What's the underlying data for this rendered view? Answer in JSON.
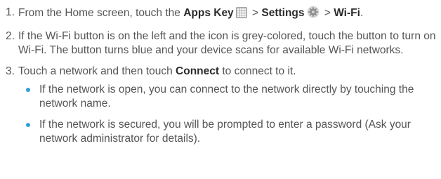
{
  "steps": [
    {
      "num": "1.",
      "t1": "From the Home screen, touch the ",
      "apps_key": "Apps Key",
      "sep1": " > ",
      "settings": "Settings",
      "sep2": " > ",
      "wifi": "Wi-Fi",
      "end": "."
    },
    {
      "num": "2.",
      "text": "If the Wi-Fi button is on the left and the icon is grey-colored, touch the button to turn on Wi-Fi. The button turns blue and your device scans for available Wi-Fi networks."
    },
    {
      "num": "3.",
      "t1": "Touch a network and then touch ",
      "connect": "Connect",
      "t2": " to connect to it."
    }
  ],
  "bullets": [
    "If the network is open, you can connect to the network directly by touching the network name.",
    "If the network is secured, you will be prompted to enter a password (Ask your network administrator for details)."
  ],
  "icons": {
    "apps": "apps-grid-icon",
    "settings": "settings-gear-icon"
  },
  "colors": {
    "text": "#555555",
    "bold_text": "#2b2b2b",
    "bullet": "#2fa0d6"
  }
}
